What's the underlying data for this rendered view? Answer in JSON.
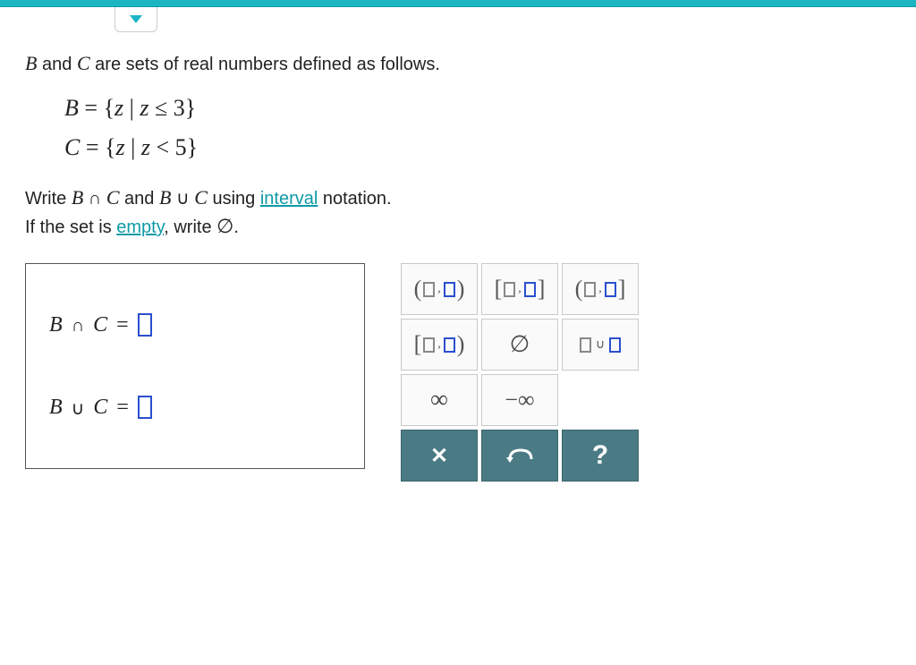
{
  "intro": {
    "pre": " and ",
    "post": " are sets of real numbers defined as follows.",
    "var1": "B",
    "var2": "C"
  },
  "sets": {
    "B": {
      "lhs": "B",
      "eq": "=",
      "open": "{",
      "var": "z",
      "bar": " | ",
      "cond_var": "z",
      "rel": " ≤ ",
      "val": "3",
      "close": "}"
    },
    "C": {
      "lhs": "C",
      "eq": "=",
      "open": "{",
      "var": "z",
      "bar": " | ",
      "cond_var": "z",
      "rel": " < ",
      "val": "5",
      "close": "}"
    }
  },
  "instructions": {
    "line1_pre": "Write ",
    "b": "B",
    "cap": " ∩ ",
    "c": "C",
    "and": " and ",
    "cup": " ∪ ",
    "line1_mid": " using ",
    "interval_link": "interval",
    "line1_post": " notation.",
    "line2_pre": "If the set is ",
    "empty_link": "empty",
    "line2_mid": ", write ",
    "empty_sym": "∅",
    "line2_post": "."
  },
  "answers": {
    "intersection": {
      "l": "B",
      "op": "∩",
      "r": "C",
      "eq": "="
    },
    "union": {
      "l": "B",
      "op": "∪",
      "r": "C",
      "eq": "="
    }
  },
  "keypad": {
    "open_open": {
      "L": "(",
      "R": ")"
    },
    "closed_closed": {
      "L": "[",
      "R": "]"
    },
    "open_closed": {
      "L": "(",
      "R": "]"
    },
    "closed_open": {
      "L": "[",
      "R": ")"
    },
    "empty": "∅",
    "union": "∪",
    "infinity": "∞",
    "neg_infinity": "−∞",
    "clear": "✕",
    "undo": "↶",
    "help": "?"
  }
}
